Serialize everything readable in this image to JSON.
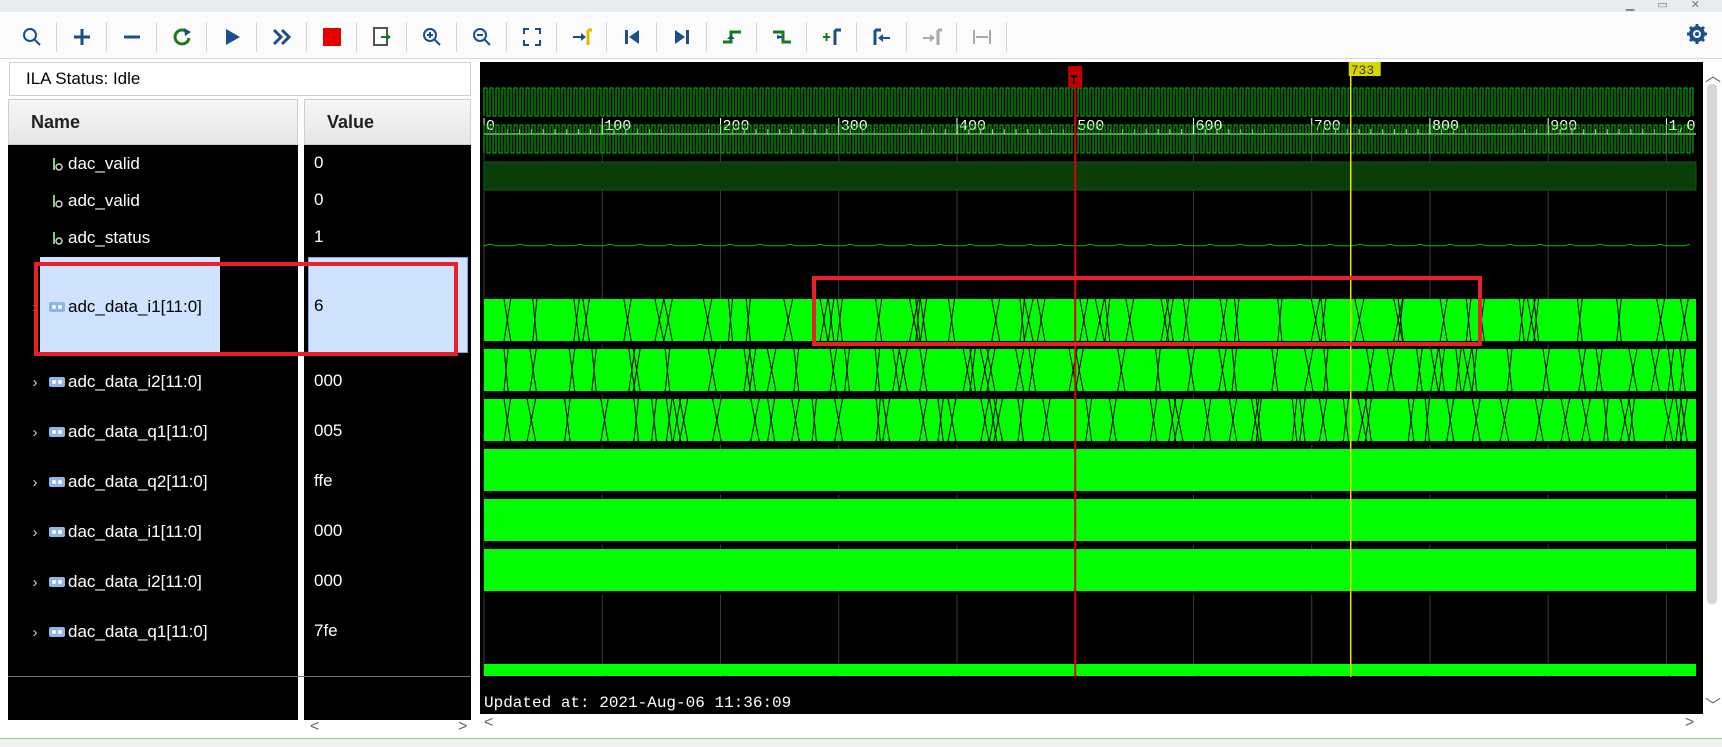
{
  "toolbar": {
    "buttons": [
      "search-icon",
      "plus-icon",
      "minus-icon",
      "refresh-icon",
      "play-icon",
      "fast-forward-icon",
      "stop-icon",
      "export-icon",
      "zoom-in-icon",
      "zoom-out-icon",
      "zoom-fit-icon",
      "go-to-cursor-icon",
      "go-to-start-icon",
      "go-to-end-icon",
      "previous-transition-icon",
      "next-transition-icon",
      "add-marker-icon",
      "previous-marker-icon",
      "next-marker-icon",
      "swap-cursors-icon"
    ],
    "settings_icon": "gear-icon"
  },
  "status": {
    "text": "ILA Status:  Idle"
  },
  "columns": {
    "name": "Name",
    "value": "Value"
  },
  "signals": [
    {
      "name": "dac_valid",
      "value": "0",
      "kind": "bit"
    },
    {
      "name": "adc_valid",
      "value": "0",
      "kind": "bit"
    },
    {
      "name": "adc_status",
      "value": "1",
      "kind": "bit"
    },
    {
      "name": "adc_data_i1[11:0]",
      "value": "6",
      "kind": "bus",
      "selected": true
    },
    {
      "name": "adc_data_i2[11:0]",
      "value": "000",
      "kind": "bus"
    },
    {
      "name": "adc_data_q1[11:0]",
      "value": "005",
      "kind": "bus"
    },
    {
      "name": "adc_data_q2[11:0]",
      "value": "ffe",
      "kind": "bus"
    },
    {
      "name": "dac_data_i1[11:0]",
      "value": "000",
      "kind": "bus"
    },
    {
      "name": "dac_data_i2[11:0]",
      "value": "000",
      "kind": "bus"
    },
    {
      "name": "dac_data_q1[11:0]",
      "value": "7fe",
      "kind": "bus"
    }
  ],
  "timeline": {
    "ticks": [
      "0",
      "100",
      "200",
      "300",
      "400",
      "500",
      "600",
      "700",
      "800",
      "900",
      "1,0"
    ],
    "trigger_marker": "T",
    "cursor_label": "733",
    "trigger_at": 500,
    "cursor_at": 733
  },
  "updated": "Updated at: 2021-Aug-06 11:36:09",
  "colors": {
    "wave_green": "#00c800",
    "wave_bright": "#00ff00",
    "trigger_red": "#e00000",
    "cursor_yellow": "#e6e600",
    "annotation_red": "#e8202a"
  }
}
